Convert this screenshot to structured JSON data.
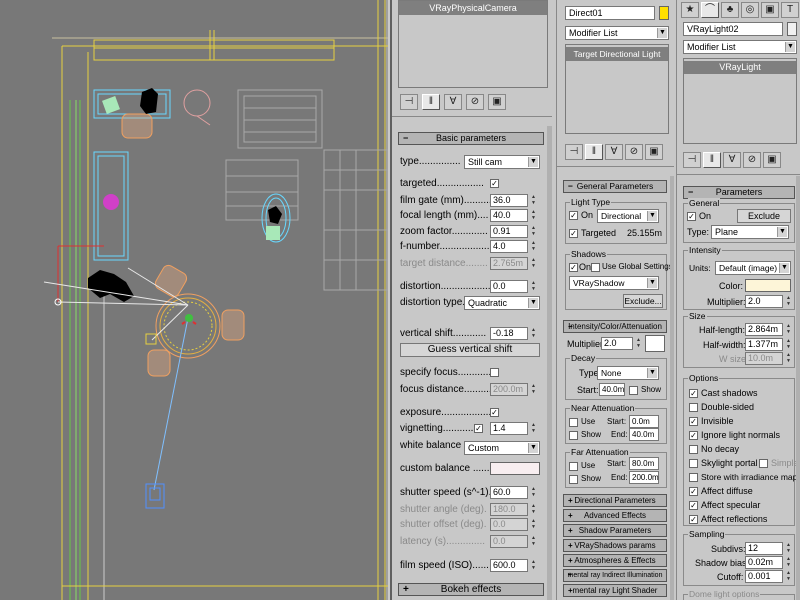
{
  "colors": {
    "viewport_bg": "#787878",
    "panel_bg": "#c8c8c8",
    "accent_yellow": "#ffe000",
    "cyan": "#68d8ff",
    "orange": "#f0a060",
    "white": "#ffffff"
  },
  "camera_panel": {
    "object_list_selected": "VRayPhysicalCamera",
    "rollout_basic": "Basic parameters",
    "type_label": "type...............",
    "type_value": "Still cam",
    "targeted_label": "targeted.................",
    "film_gate_label": "film gate (mm)..........",
    "film_gate_value": "36.0",
    "focal_length_label": "focal length (mm)....",
    "focal_length_value": "40.0",
    "zoom_factor_label": "zoom factor.............",
    "zoom_factor_value": "0.91",
    "f_number_label": "f-number..................",
    "f_number_value": "4.0",
    "target_distance_label": "target distance........",
    "target_distance_value": "2.765m",
    "distortion_label": "distortion..................",
    "distortion_value": "0.0",
    "distortion_type_label": "distortion type.",
    "distortion_type_value": "Quadratic",
    "vertical_shift_label": "vertical shift............",
    "vertical_shift_value": "-0.18",
    "guess_vertical_shift": "Guess vertical shift",
    "specify_focus_label": "specify focus............",
    "focus_distance_label": "focus distance..........",
    "focus_distance_value": "200.0m",
    "exposure_label": "exposure..................",
    "vignetting_label": "vignetting.............",
    "vignetting_value": "1.4",
    "white_balance_label": "white balance",
    "white_balance_value": "Custom",
    "custom_balance_label": "custom balance ......",
    "shutter_speed_label": "shutter speed (s^-1).",
    "shutter_speed_value": "60.0",
    "shutter_angle_label": "shutter angle (deg).",
    "shutter_angle_value": "180.0",
    "shutter_offset_label": "shutter offset (deg).",
    "shutter_offset_value": "0.0",
    "latency_label": "latency (s)..............",
    "latency_value": "0.0",
    "film_speed_label": "film speed (ISO)......",
    "film_speed_value": "600.0",
    "rollout_bokeh": "Bokeh effects"
  },
  "dir_light_panel": {
    "name": "Direct01",
    "modifier_list": "Modifier List",
    "stack_item": "Target Directional Light",
    "rollout_general": "General Parameters",
    "light_type_group": "Light Type",
    "on_label": "On",
    "light_type_value": "Directional",
    "targeted_label": "Targeted",
    "target_distance": "25.155m",
    "shadows_group": "Shadows",
    "shadows_on": "On",
    "use_global": "Use Global Settings",
    "shadow_type": "VRayShadow",
    "exclude_btn": "Exclude...",
    "rollout_intensity": "Intensity/Color/Attenuation",
    "multiplier_label": "Multiplier:",
    "multiplier_value": "2.0",
    "decay_group": "Decay",
    "decay_type_label": "Type:",
    "decay_type_value": "None",
    "decay_start_label": "Start:",
    "decay_start_value": "40.0m",
    "show_label": "Show",
    "near_group": "Near Attenuation",
    "use_label": "Use",
    "start_label": "Start:",
    "end_label": "End:",
    "near_start_value": "0.0m",
    "near_end_value": "40.0m",
    "far_group": "Far Attenuation",
    "far_start_value": "80.0m",
    "far_end_value": "200.0m",
    "collapsed_rollouts": [
      "Directional Parameters",
      "Advanced Effects",
      "Shadow Parameters",
      "VRayShadows params",
      "Atmospheres & Effects",
      "mental ray Indirect Illumination",
      "mental ray Light Shader"
    ]
  },
  "vraylight_panel": {
    "name": "VRayLight02",
    "modifier_list": "Modifier List",
    "stack_item": "VRayLight",
    "rollout_params": "Parameters",
    "general_group": "General",
    "on_label": "On",
    "exclude_btn": "Exclude",
    "type_label": "Type:",
    "type_value": "Plane",
    "intensity_group": "Intensity",
    "units_label": "Units:",
    "units_value": "Default (image)",
    "color_label": "Color:",
    "multiplier_label": "Multiplier:",
    "multiplier_value": "2.0",
    "size_group": "Size",
    "half_length_label": "Half-length:",
    "half_length_value": "2.864m",
    "half_width_label": "Half-width:",
    "half_width_value": "1.377m",
    "w_size_label": "W size",
    "w_size_value": "10.0m",
    "options_group": "Options",
    "options": [
      "Cast shadows",
      "Double-sided",
      "Invisible",
      "Ignore light normals",
      "No decay",
      "Skylight portal",
      "Store with irradiance map",
      "Affect diffuse",
      "Affect specular",
      "Affect reflections"
    ],
    "simple_label": "Simple",
    "sampling_group": "Sampling",
    "subdivs_label": "Subdivs:",
    "subdivs_value": "12",
    "shadow_bias_label": "Shadow bias:",
    "shadow_bias_value": "0.02m",
    "cutoff_label": "Cutoff:",
    "cutoff_value": "0.001",
    "dome_light_group": "Dome light options"
  }
}
